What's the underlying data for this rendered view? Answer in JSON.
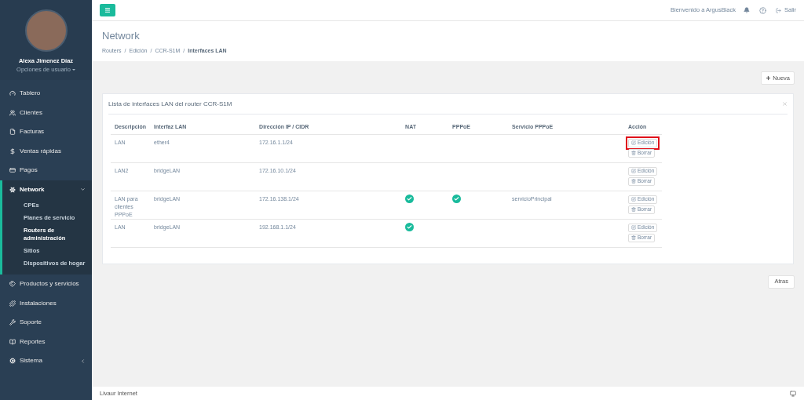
{
  "sidebar": {
    "user": {
      "name": "Alexa Jimenez Díaz",
      "options": "Opciones de usuario"
    },
    "items": [
      {
        "label": "Tablero",
        "selected": false
      },
      {
        "label": "Clientes",
        "selected": false
      },
      {
        "label": "Facturas",
        "selected": false
      },
      {
        "label": "Ventas rápidas",
        "selected": false
      },
      {
        "label": "Pagos",
        "selected": false
      },
      {
        "label": "Network",
        "selected": true,
        "expanded": true,
        "children": [
          {
            "label": "CPEs",
            "selected": false
          },
          {
            "label": "Planes de servicio",
            "selected": false
          },
          {
            "label": "Routers de administración",
            "selected": true
          },
          {
            "label": "Sitios",
            "selected": false
          },
          {
            "label": "Dispositivos de hogar",
            "selected": false
          }
        ]
      },
      {
        "label": "Productos y servicios",
        "selected": false
      },
      {
        "label": "Instalaciones",
        "selected": false
      },
      {
        "label": "Soporte",
        "selected": false
      },
      {
        "label": "Reportes",
        "selected": false
      },
      {
        "label": "Sistema",
        "selected": false,
        "expanded": false
      }
    ]
  },
  "topbar": {
    "welcome": "Bienvenido a ArgusBlack",
    "logout": "Salir"
  },
  "page": {
    "title": "Network",
    "breadcrumbs": [
      "Routers",
      "Edición",
      "CCR-S1M",
      "Interfaces LAN"
    ],
    "breadcrumb_separator": "/"
  },
  "new_button": "Nueva",
  "panel": {
    "title": "Lista de interfaces LAN del router CCR-S1M",
    "columns": [
      "Descripción",
      "Interfaz LAN",
      "Dirección IP / CIDR",
      "NAT",
      "PPPoE",
      "Servicio PPPoE",
      "Acción"
    ],
    "rows": [
      {
        "description": "LAN",
        "interface": "ether4",
        "ip": "172.16.1.1/24",
        "nat": false,
        "pppoe": false,
        "edit": "Edición",
        "delete": "Borrar",
        "highlighted": true
      },
      {
        "description": "LAN2",
        "interface": "bridgeLAN",
        "ip": "172.16.10.1/24",
        "nat": false,
        "pppoe": false,
        "edit": "Edición",
        "delete": "Borrar",
        "highlighted": false
      },
      {
        "description": "LAN para clientes PPPoE",
        "interface": "bridgeLAN",
        "ip": "172.16.138.1/24",
        "nat": true,
        "pppoe": true,
        "service": "servicioPrincipal",
        "edit": "Edición",
        "delete": "Borrar",
        "highlighted": false
      },
      {
        "description": "LAN",
        "interface": "bridgeLAN",
        "ip": "192.168.1.1/24",
        "nat": true,
        "pppoe": false,
        "edit": "Edición",
        "delete": "Borrar",
        "highlighted": false
      }
    ]
  },
  "back_button": "Atras",
  "footer": {
    "text": "Livaur Internet"
  }
}
